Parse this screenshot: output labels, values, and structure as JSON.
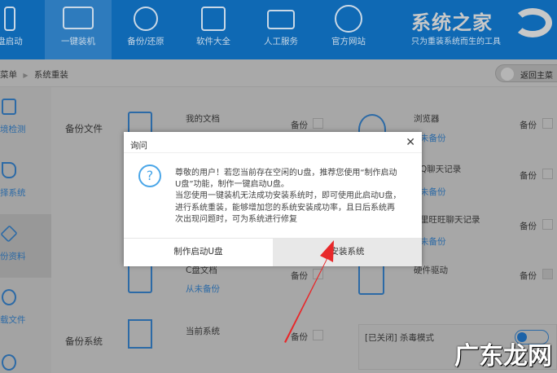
{
  "nav": [
    {
      "label": "盘启动",
      "icon": "usb-icon"
    },
    {
      "label": "一键装机",
      "icon": "monitor-windows-icon",
      "active": true
    },
    {
      "label": "备份/还原",
      "icon": "database-restore-icon"
    },
    {
      "label": "软件大全",
      "icon": "apps-icon"
    },
    {
      "label": "人工服务",
      "icon": "chat-icon"
    },
    {
      "label": "官方网站",
      "icon": "globe-icon"
    }
  ],
  "brand": {
    "logo": "系统之家",
    "tagline": "只为重装系统而生的工具"
  },
  "breadcrumb": {
    "parent": "菜单",
    "sep": "▶",
    "current": "系统重装"
  },
  "back_button": "返回主菜",
  "sidebar": [
    {
      "label": "境检测"
    },
    {
      "label": "择系统"
    },
    {
      "label": "份资料",
      "active": true
    },
    {
      "label": "载文件"
    }
  ],
  "sections": {
    "files": "备份文件",
    "system": "备份系统"
  },
  "items": [
    {
      "name": "我的文档",
      "status": "",
      "backup": "备份",
      "checked": false
    },
    {
      "name": "浏览器",
      "status": "未备份",
      "backup": "备份",
      "checked": false
    },
    {
      "name": "Q聊天记录",
      "status": "未备份",
      "backup": "备份",
      "checked": false
    },
    {
      "name": "里旺旺聊天记录",
      "status": "未备份",
      "backup": "备份",
      "checked": false
    },
    {
      "name": "C盘文档",
      "status": "从未备份",
      "backup": "备份",
      "checked": false
    },
    {
      "name": "硬件驱动",
      "status": "",
      "backup": "备份",
      "checked": true
    },
    {
      "name": "当前系统",
      "status": "",
      "backup": "备份",
      "checked": false
    }
  ],
  "antivirus": {
    "label": "[已关闭] 杀毒模式",
    "on": false
  },
  "dialog": {
    "title": "询问",
    "close": "✕",
    "icon": "?",
    "lines": [
      "尊敬的用户！若您当前存在空闲的U盘，推荐您使用“制作启动",
      "U盘”功能，制作一键启动U盘。",
      "当您使用一键装机无法成功安装系统时，即可使用此启动U盘，",
      "进行系统重装，能够增加您的系统安装成功率，且日后系统再",
      "次出现问题时，可为系统进行修复"
    ],
    "make_usb": "制作启动U盘",
    "install": "安装系统"
  },
  "watermark": "广东龙网"
}
